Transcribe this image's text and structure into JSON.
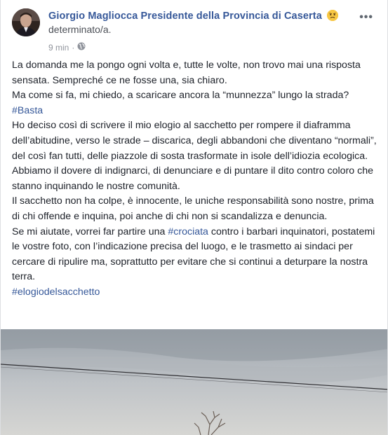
{
  "post": {
    "author": "Giorgio Magliocca Presidente della Provincia di Caserta",
    "feeling": "determinato/a.",
    "time": "9 min",
    "privacy_icon": "globe-icon",
    "options_icon": "more-options-icon",
    "emoji_icon": "determined-face-emoji"
  },
  "content": {
    "line1": "La domanda me la pongo ogni volta e, tutte le volte, non trovo mai una risposta sensata. Sempreché ce ne fosse una, sia chiaro.",
    "line2": "Ma come si fa, mi chiedo, a scaricare ancora la “munnezza” lungo la strada?",
    "hashtag1": "#Basta",
    "line3": "Ho deciso così di scrivere il mio elogio al sacchetto per rompere il diaframma dell’abitudine, verso le strade – discarica, degli abbandoni che diventano “normali”, del così fan tutti, delle piazzole di sosta trasformate in isole dell’idiozia ecologica.",
    "line4": "Abbiamo il dovere di indignarci, di denunciare e di puntare il dito contro coloro che stanno inquinando le nostre comunità.",
    "line5": "Il sacchetto non ha colpe, è innocente, le uniche responsabilità sono nostre, prima di chi offende e inquina, poi anche di chi non si scandalizza e denuncia.",
    "line6_before": "Se mi aiutate, vorrei far partire una ",
    "hashtag2": "#crociata",
    "line6_after": " contro i barbari inquinatori, postatemi le vostre foto, con l’indicazione precisa del luogo, e le trasmetto ai sindaci per cercare di ripulire ma, soprattutto per evitare che si continui a deturpare la nostra terra.",
    "hashtag3": "#elogiodelsacchetto"
  },
  "colors": {
    "link": "#365899",
    "meta": "#90949c",
    "text": "#1d2129"
  }
}
